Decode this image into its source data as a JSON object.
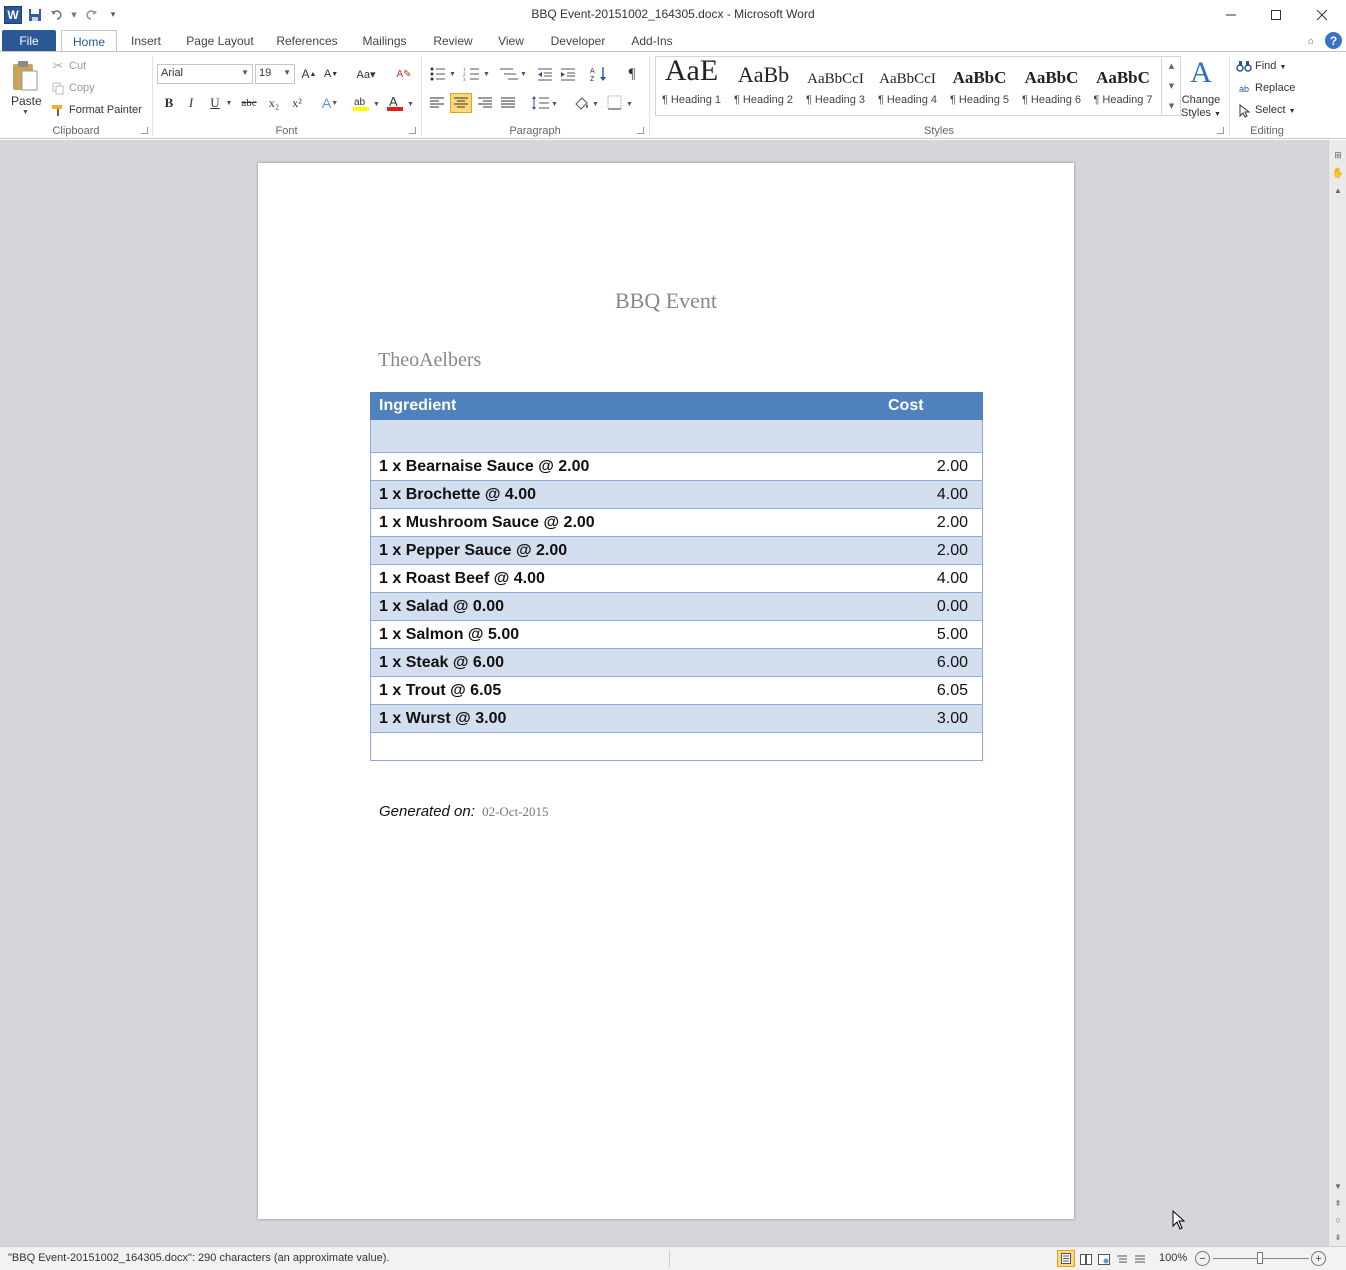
{
  "window": {
    "title": "BBQ Event-20151002_164305.docx - Microsoft Word",
    "app_icon": "W"
  },
  "tabs": [
    "File",
    "Home",
    "Insert",
    "Page Layout",
    "References",
    "Mailings",
    "Review",
    "View",
    "Developer",
    "Add-Ins"
  ],
  "clipboard": {
    "paste": "Paste",
    "cut": "Cut",
    "copy": "Copy",
    "format_painter": "Format Painter",
    "label": "Clipboard"
  },
  "font": {
    "name": "Arial",
    "size": "19",
    "label": "Font",
    "bold": "B",
    "italic": "I",
    "underline": "U",
    "strike": "abc",
    "subscript": "x₂",
    "superscript": "x²"
  },
  "paragraph": {
    "label": "Paragraph"
  },
  "styles": {
    "label": "Styles",
    "items": [
      {
        "sample": "AaE",
        "name": "¶ Heading 1"
      },
      {
        "sample": "AaBb",
        "name": "¶ Heading 2"
      },
      {
        "sample": "AaBbCcI",
        "name": "¶ Heading 3"
      },
      {
        "sample": "AaBbCcI",
        "name": "¶ Heading 4"
      },
      {
        "sample": "AaBbC",
        "name": "¶ Heading 5"
      },
      {
        "sample": "AaBbC",
        "name": "¶ Heading 6"
      },
      {
        "sample": "AaBbC",
        "name": "¶ Heading 7"
      }
    ],
    "change_styles_line1": "Change",
    "change_styles_line2": "Styles"
  },
  "editing": {
    "label": "Editing",
    "find": "Find",
    "replace": "Replace",
    "select": "Select"
  },
  "document": {
    "title": "BBQ Event",
    "author": "TheoAelbers",
    "table": {
      "headers": [
        "Ingredient",
        "Cost"
      ],
      "rows": [
        [
          "",
          ""
        ],
        [
          "1 x Bearnaise Sauce @ 2.00",
          "2.00"
        ],
        [
          "1 x Brochette @ 4.00",
          "4.00"
        ],
        [
          "1 x Mushroom Sauce @ 2.00",
          "2.00"
        ],
        [
          "1 x Pepper Sauce @ 2.00",
          "2.00"
        ],
        [
          "1 x Roast Beef @ 4.00",
          "4.00"
        ],
        [
          "1 x Salad @ 0.00",
          "0.00"
        ],
        [
          "1 x Salmon @ 5.00",
          "5.00"
        ],
        [
          "1 x Steak @ 6.00",
          "6.00"
        ],
        [
          "1 x Trout @ 6.05",
          "6.05"
        ],
        [
          "1 x Wurst @ 3.00",
          "3.00"
        ],
        [
          "",
          ""
        ]
      ]
    },
    "generated_label": "Generated on:",
    "generated_date": "02-Oct-2015"
  },
  "status": {
    "text": "\"BBQ Event-20151002_164305.docx\": 290 characters (an approximate value).",
    "zoom": "100%"
  },
  "colors": {
    "file_tab": "#2b5797",
    "table_header": "#4f81bd",
    "table_band": "#d3dfee"
  }
}
